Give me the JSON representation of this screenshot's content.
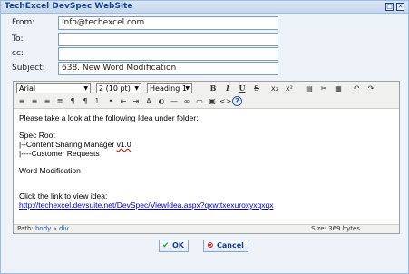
{
  "window": {
    "title": "TechExcel DevSpec WebSite",
    "restore_glyph": "□",
    "close_glyph": "✕"
  },
  "form": {
    "from_label": "From:",
    "from_value": "info@techexcel.com",
    "to_label": "To:",
    "to_value": "",
    "cc_label": "cc:",
    "cc_value": "",
    "subject_label": "Subject:",
    "subject_value": "638. New Word Modification"
  },
  "toolbar": {
    "font_family": "Arial",
    "font_size": "2 (10 pt)",
    "heading": "Heading 1",
    "bold": "B",
    "italic": "I",
    "underline": "U",
    "strike": "S",
    "subscript": "x₂",
    "superscript": "x²",
    "undo": "↶",
    "redo": "↷",
    "help": "?"
  },
  "content": {
    "line1": "Please take a look at the following Idea under folder:",
    "line2": "Spec Root",
    "line3_prefix": "|--Content Sharing Manager ",
    "line3_version": "v1.0",
    "line4": "|----Customer Requests",
    "line5": "Word Modification",
    "line6": "Click the link to view idea:",
    "link": "http://techexcel.devsuite.net/DevSpec/ViewIdea.aspx?qxwttxexuroxyxqxqx"
  },
  "status": {
    "path_label": "Path:",
    "path_body": "body",
    "path_sep": "»",
    "path_div": "div",
    "size": "Size: 369 bytes"
  },
  "buttons": {
    "ok_label": "OK",
    "cancel_label": "Cancel"
  },
  "colors": {
    "title_text": "#15428b",
    "ok_icon": "#2a9d2a",
    "cancel_icon": "#cc2222"
  }
}
